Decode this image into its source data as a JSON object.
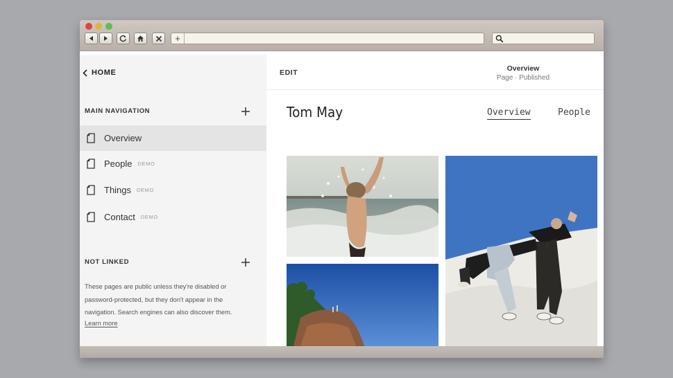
{
  "browser": {
    "toolbar_buttons": [
      "back-icon",
      "forward-icon",
      "reload-icon",
      "home-icon",
      "stop-icon"
    ],
    "address_add_symbol": "+",
    "address_value": "",
    "search_value": ""
  },
  "sidebar": {
    "home_label": "HOME",
    "main_nav_heading": "MAIN NAVIGATION",
    "items": [
      {
        "label": "Overview",
        "badge": ""
      },
      {
        "label": "People",
        "badge": "DEMO"
      },
      {
        "label": "Things",
        "badge": "DEMO"
      },
      {
        "label": "Contact",
        "badge": "DEMO"
      }
    ],
    "not_linked_heading": "NOT LINKED",
    "not_linked_text": "These pages are public unless they're disabled or password-protected, but they don't appear in the navigation. Search engines can also discover them.",
    "learn_more": "Learn more"
  },
  "editor": {
    "edit_label": "EDIT",
    "page_title": "Overview",
    "page_status": "Page · Published"
  },
  "site": {
    "title": "Tom May",
    "tabs": [
      "Overview",
      "People"
    ],
    "active_tab": "Overview"
  },
  "colors": {
    "page_background": "#a8a9ad",
    "sidebar_background": "#f4f4f4",
    "active_item": "#e4e4e4",
    "sky": "#3f74c2"
  }
}
